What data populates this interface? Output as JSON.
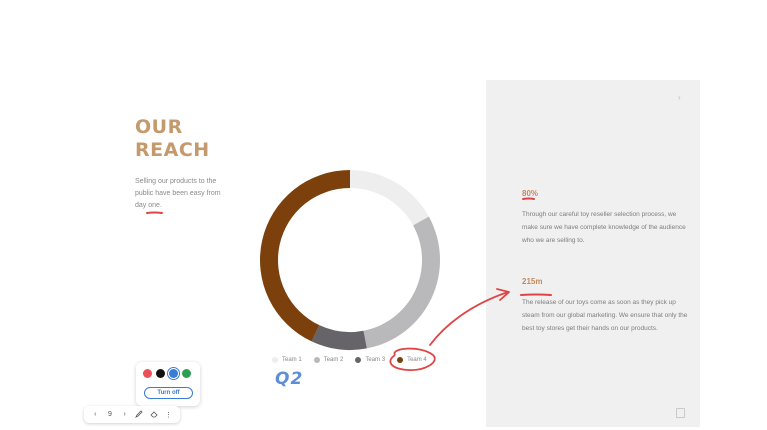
{
  "slide": {
    "title_line1": "OUR",
    "title_line2": "REACH",
    "description": "Selling our products to the public have been easy from day one."
  },
  "chart_data": {
    "type": "pie",
    "categories": [
      "Team 1",
      "Team 2",
      "Team 3",
      "Team 4"
    ],
    "values": [
      17,
      30,
      10,
      43
    ],
    "colors": [
      "#eeeeef",
      "#b9b8ba",
      "#666468",
      "#7b400b"
    ],
    "legend": "bottom"
  },
  "legend": {
    "items": [
      {
        "label": "Team 1",
        "color": "#eeeeef"
      },
      {
        "label": "Team 2",
        "color": "#b9b8ba"
      },
      {
        "label": "Team 3",
        "color": "#666468"
      },
      {
        "label": "Team 4",
        "color": "#7b400b"
      }
    ]
  },
  "panel": {
    "close_icon": "chevron-right-icon",
    "stat1_value": "80%",
    "stat1_desc": "Through our careful toy reseller selection process, we make sure we have complete knowledge of the audience who we are selling to.",
    "stat2_value": "215m",
    "stat2_desc": "The release of our toys come as soon as they pick up steam from our global marketing. We ensure that only the best toy stores get their hands on our products."
  },
  "annotation": {
    "handwritten_text": "Q2",
    "ink_red": "#e04545",
    "ink_blue": "#5e8fd6"
  },
  "pen_popup": {
    "colors": [
      "#e8505b",
      "#111111",
      "#3a7bd5",
      "#2e9e55"
    ],
    "selected_color": "#3a7bd5",
    "turn_off_label": "Turn off"
  },
  "toolbar": {
    "prev_icon": "‹",
    "page_number": "9",
    "next_icon": "›",
    "pen_icon": "pen-icon",
    "eraser_icon": "eraser-icon",
    "more_icon": "⋮"
  }
}
